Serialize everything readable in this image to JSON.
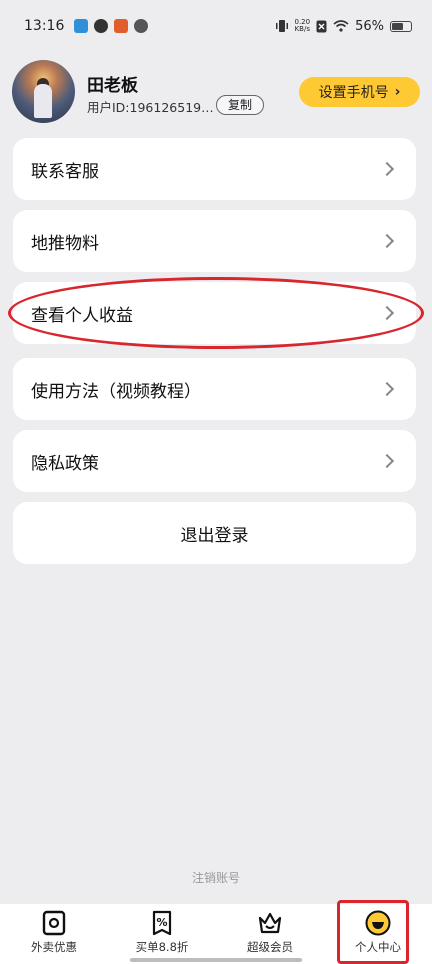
{
  "status_bar": {
    "time": "13:16",
    "net_speed_value": "0.20",
    "net_speed_unit": "KB/s",
    "battery_text": "56%"
  },
  "profile": {
    "name": "田老板",
    "user_id": "用户ID:196126519…",
    "copy_label": "复制",
    "phone_button_label": "设置手机号",
    "phone_button_chevron": "›"
  },
  "menu": [
    {
      "label": "联系客服"
    },
    {
      "label": "地推物料"
    },
    {
      "label": "查看个人收益"
    },
    {
      "label": "使用方法（视频教程）"
    },
    {
      "label": "隐私政策"
    }
  ],
  "logout_label": "退出登录",
  "deregister_label": "注销账号",
  "tabs": [
    {
      "label": "外卖优惠",
      "icon": "coupon-icon"
    },
    {
      "label": "买单8.8折",
      "icon": "percent-icon"
    },
    {
      "label": "超级会员",
      "icon": "crown-icon"
    },
    {
      "label": "个人中心",
      "icon": "smiley-icon"
    }
  ],
  "colors": {
    "accent_yellow": "#ffc933",
    "highlight_red": "#d8262c",
    "background": "#ededf0"
  }
}
